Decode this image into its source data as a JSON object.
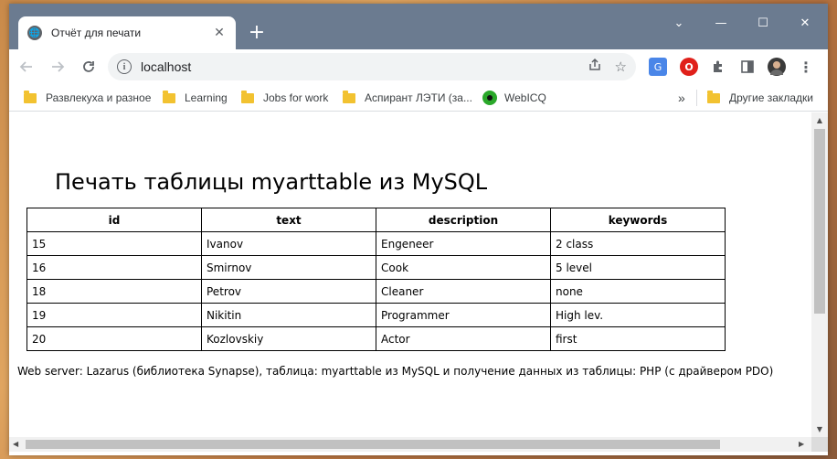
{
  "browser": {
    "tab_title": "Отчёт для печати",
    "new_tab_label": "+",
    "url": "localhost",
    "window_controls": {
      "minimize": "—",
      "maximize": "☐",
      "close": "✕",
      "tab_search": "⌄"
    }
  },
  "bookmarks": [
    {
      "label": "Развлекуха и разное",
      "icon": "folder-icon"
    },
    {
      "label": "Learning",
      "icon": "folder-icon"
    },
    {
      "label": "Jobs for work",
      "icon": "folder-icon"
    },
    {
      "label": "Аспирант ЛЭТИ (за...",
      "icon": "folder-icon"
    },
    {
      "label": "WebICQ",
      "icon": "webicq-icon"
    }
  ],
  "bookmarks_overflow": "»",
  "other_bookmarks": "Другие закладки",
  "page": {
    "title": "Печать таблицы myarttable из MySQL",
    "table": {
      "headers": [
        "id",
        "text",
        "description",
        "keywords"
      ],
      "rows": [
        [
          "15",
          "Ivanov",
          "Engeneer",
          "2 class"
        ],
        [
          "16",
          "Smirnov",
          "Cook",
          "5 level"
        ],
        [
          "18",
          "Petrov",
          "Cleaner",
          "none"
        ],
        [
          "19",
          "Nikitin",
          "Programmer",
          "High lev."
        ],
        [
          "20",
          "Kozlovskiy",
          "Actor",
          "first"
        ]
      ]
    },
    "footer": "Web server: Lazarus (библиотека Synapse), таблица: myarttable из MySQL и получение данных из таблицы: PHP (с драйвером PDO)"
  },
  "colors": {
    "titlebar": "#6b7b90",
    "folder": "#f2c230"
  }
}
